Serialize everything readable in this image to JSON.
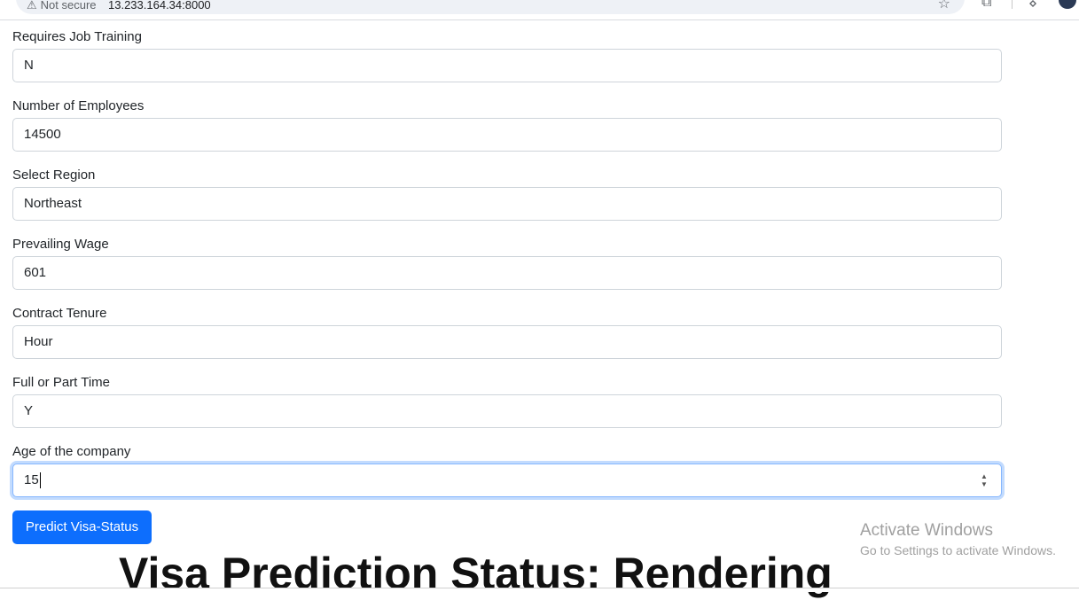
{
  "browser": {
    "security_label": "Not secure",
    "url": "13.233.164.34:8000"
  },
  "form": {
    "fields": [
      {
        "label": "Requires Job Training",
        "value": "N"
      },
      {
        "label": "Number of Employees",
        "value": "14500"
      },
      {
        "label": "Select Region",
        "value": "Northeast"
      },
      {
        "label": "Prevailing Wage",
        "value": "601"
      },
      {
        "label": "Contract Tenure",
        "value": "Hour"
      },
      {
        "label": "Full or Part Time",
        "value": "Y"
      },
      {
        "label": "Age of the company",
        "value": "15"
      }
    ],
    "submit_label": "Predict Visa-Status"
  },
  "result": {
    "text": "Visa Prediction Status: Rendering"
  },
  "watermark": {
    "title": "Activate Windows",
    "subtitle": "Go to Settings to activate Windows."
  },
  "colors": {
    "primary": "#0d6efd",
    "focus_border": "#86b7fe"
  }
}
